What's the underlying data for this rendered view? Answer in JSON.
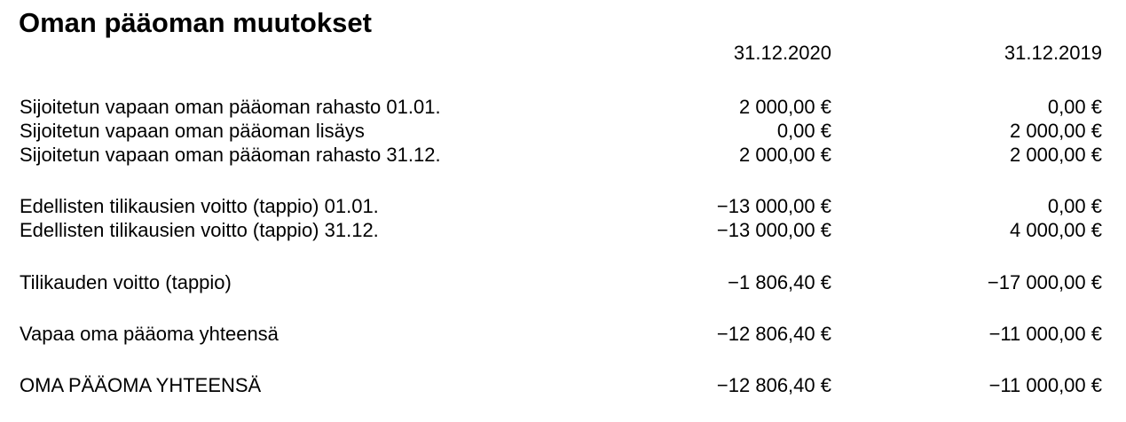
{
  "title": "Oman pääoman muutokset",
  "columns": [
    "31.12.2020",
    "31.12.2019"
  ],
  "rows": [
    {
      "label": "Sijoitetun vapaan oman pääoman rahasto 01.01.",
      "v2020": "2 000,00 €",
      "v2019": "0,00 €"
    },
    {
      "label": "Sijoitetun vapaan oman pääoman lisäys",
      "v2020": "0,00 €",
      "v2019": "2 000,00 €"
    },
    {
      "label": "Sijoitetun vapaan oman pääoman rahasto 31.12.",
      "v2020": "2 000,00 €",
      "v2019": "2 000,00 €"
    },
    {
      "label": "Edellisten tilikausien voitto (tappio) 01.01.",
      "v2020": "−13 000,00 €",
      "v2019": "0,00 €"
    },
    {
      "label": "Edellisten tilikausien voitto (tappio) 31.12.",
      "v2020": "−13 000,00 €",
      "v2019": "4 000,00 €"
    },
    {
      "label": "Tilikauden voitto (tappio)",
      "v2020": "−1 806,40 €",
      "v2019": "−17 000,00 €"
    },
    {
      "label": "Vapaa oma pääoma yhteensä",
      "v2020": "−12 806,40 €",
      "v2019": "−11 000,00 €"
    },
    {
      "label": "OMA PÄÄOMA YHTEENSÄ",
      "v2020": "−12 806,40 €",
      "v2019": "−11 000,00 €"
    }
  ]
}
